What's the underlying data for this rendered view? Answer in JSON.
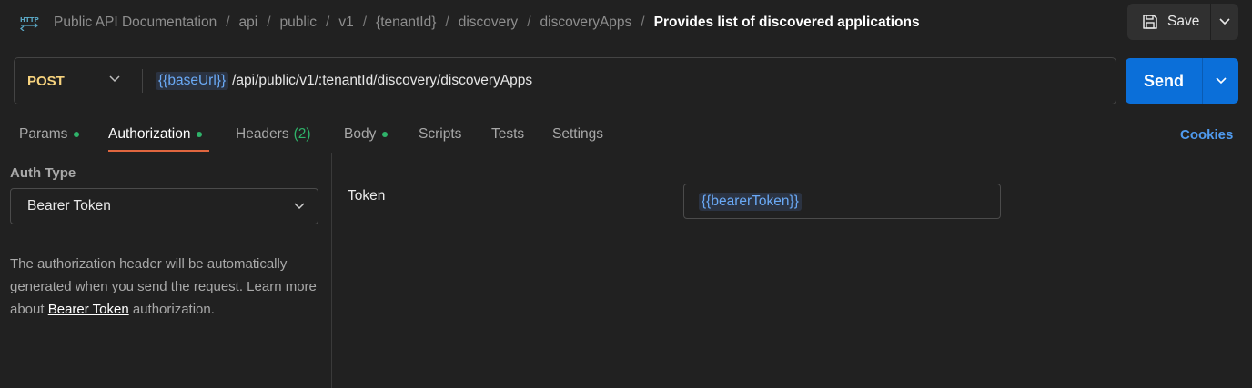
{
  "breadcrumb": {
    "items": [
      "Public API Documentation",
      "api",
      "public",
      "v1",
      "{tenantId}",
      "discovery",
      "discoveryApps"
    ],
    "separator": "/",
    "current": "Provides list of discovered applications"
  },
  "header": {
    "icon": "http-icon",
    "save_label": "Save"
  },
  "request": {
    "method": "POST",
    "url_variable": "{{baseUrl}}",
    "url_path": "/api/public/v1/:tenantId/discovery/discoveryApps",
    "send_label": "Send"
  },
  "tabs": [
    {
      "label": "Params",
      "dot": true
    },
    {
      "label": "Authorization",
      "dot": true,
      "active": true
    },
    {
      "label": "Headers",
      "count": "(2)"
    },
    {
      "label": "Body",
      "dot": true
    },
    {
      "label": "Scripts"
    },
    {
      "label": "Tests"
    },
    {
      "label": "Settings"
    }
  ],
  "cookies_label": "Cookies",
  "auth": {
    "type_label": "Auth Type",
    "type_value": "Bearer Token",
    "description_before": "The authorization header will be automatically generated when you send the request. Learn more about ",
    "description_link": "Bearer Token",
    "description_after": " authorization.",
    "token_label": "Token",
    "token_value": "{{bearerToken}}"
  },
  "colors": {
    "background": "#212121",
    "method": "#f7d37e",
    "send_button": "#0b6fd9",
    "active_tab_underline": "#e0663f",
    "status_dot": "#2fb36a",
    "variable": "#6aa9f5",
    "cookies_link": "#4f9bf0"
  }
}
